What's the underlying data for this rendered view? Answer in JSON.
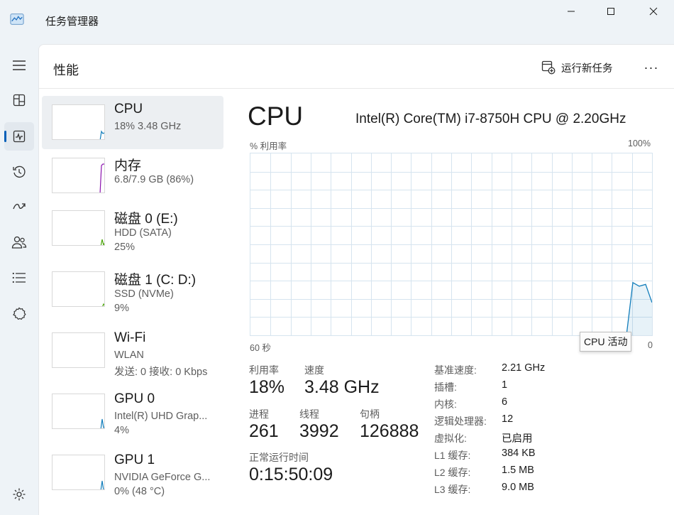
{
  "app": {
    "title": "任务管理器",
    "icon": "task-manager-icon"
  },
  "window_controls": [
    "minimize-icon",
    "maximize-icon",
    "close-icon"
  ],
  "nav": {
    "items": [
      {
        "name": "menu",
        "icon": "hamburger-icon"
      },
      {
        "name": "processes",
        "icon": "processes-icon"
      },
      {
        "name": "performance",
        "icon": "performance-icon",
        "active": true
      },
      {
        "name": "app-history",
        "icon": "history-icon"
      },
      {
        "name": "startup-apps",
        "icon": "startup-icon"
      },
      {
        "name": "users",
        "icon": "users-icon"
      },
      {
        "name": "details",
        "icon": "details-icon"
      },
      {
        "name": "services",
        "icon": "services-icon"
      },
      {
        "name": "settings",
        "icon": "settings-icon"
      }
    ]
  },
  "header": {
    "title": "性能",
    "run_task_label": "运行新任务",
    "more_label": "···"
  },
  "resources": [
    {
      "id": "cpu",
      "name": "CPU",
      "sub1": "18% 3.48 GHz",
      "sub2": "",
      "color": "#117dbb",
      "selected": true
    },
    {
      "id": "memory",
      "name": "内存",
      "sub1": "6.8/7.9 GB (86%)",
      "sub2": "",
      "color": "#8b12ae"
    },
    {
      "id": "disk0",
      "name": "磁盘 0 (E:)",
      "sub1": "HDD (SATA)",
      "sub2": "25%",
      "color": "#4da60c"
    },
    {
      "id": "disk1",
      "name": "磁盘 1 (C: D:)",
      "sub1": "SSD (NVMe)",
      "sub2": "9%",
      "color": "#4da60c"
    },
    {
      "id": "wifi",
      "name": "Wi-Fi",
      "sub1": "WLAN",
      "sub2": "发送: 0 接收: 0 Kbps",
      "color": "#a74f01"
    },
    {
      "id": "gpu0",
      "name": "GPU 0",
      "sub1": "Intel(R) UHD Grap...",
      "sub2": "4%",
      "color": "#117dbb"
    },
    {
      "id": "gpu1",
      "name": "GPU 1",
      "sub1": "NVIDIA GeForce G...",
      "sub2": "0% (48 °C)",
      "color": "#117dbb"
    }
  ],
  "detail": {
    "title": "CPU",
    "model": "Intel(R) Core(TM) i7-8750H CPU @ 2.20GHz",
    "graph": {
      "y_label": "% 利用率",
      "y_max_label": "100%",
      "x_left_label": "60 秒",
      "y_min_label": "0",
      "tooltip": "CPU 活动",
      "line_color": "#117dbb",
      "utilization_last_seconds": [
        0,
        0,
        0,
        0,
        29,
        27,
        28,
        18
      ]
    },
    "stats": {
      "utilization_label": "利用率",
      "utilization_value": "18%",
      "speed_label": "速度",
      "speed_value": "3.48 GHz",
      "processes_label": "进程",
      "processes_value": "261",
      "threads_label": "线程",
      "threads_value": "3992",
      "handles_label": "句柄",
      "handles_value": "126888",
      "uptime_label": "正常运行时间",
      "uptime_value": "0:15:50:09"
    },
    "specs": [
      {
        "key": "基准速度:",
        "value": "2.21 GHz"
      },
      {
        "key": "插槽:",
        "value": "1"
      },
      {
        "key": "内核:",
        "value": "6"
      },
      {
        "key": "逻辑处理器:",
        "value": "12"
      },
      {
        "key": "虚拟化:",
        "value": "已启用"
      },
      {
        "key": "L1 缓存:",
        "value": "384 KB"
      },
      {
        "key": "L2 缓存:",
        "value": "1.5 MB"
      },
      {
        "key": "L3 缓存:",
        "value": "9.0 MB"
      }
    ]
  }
}
